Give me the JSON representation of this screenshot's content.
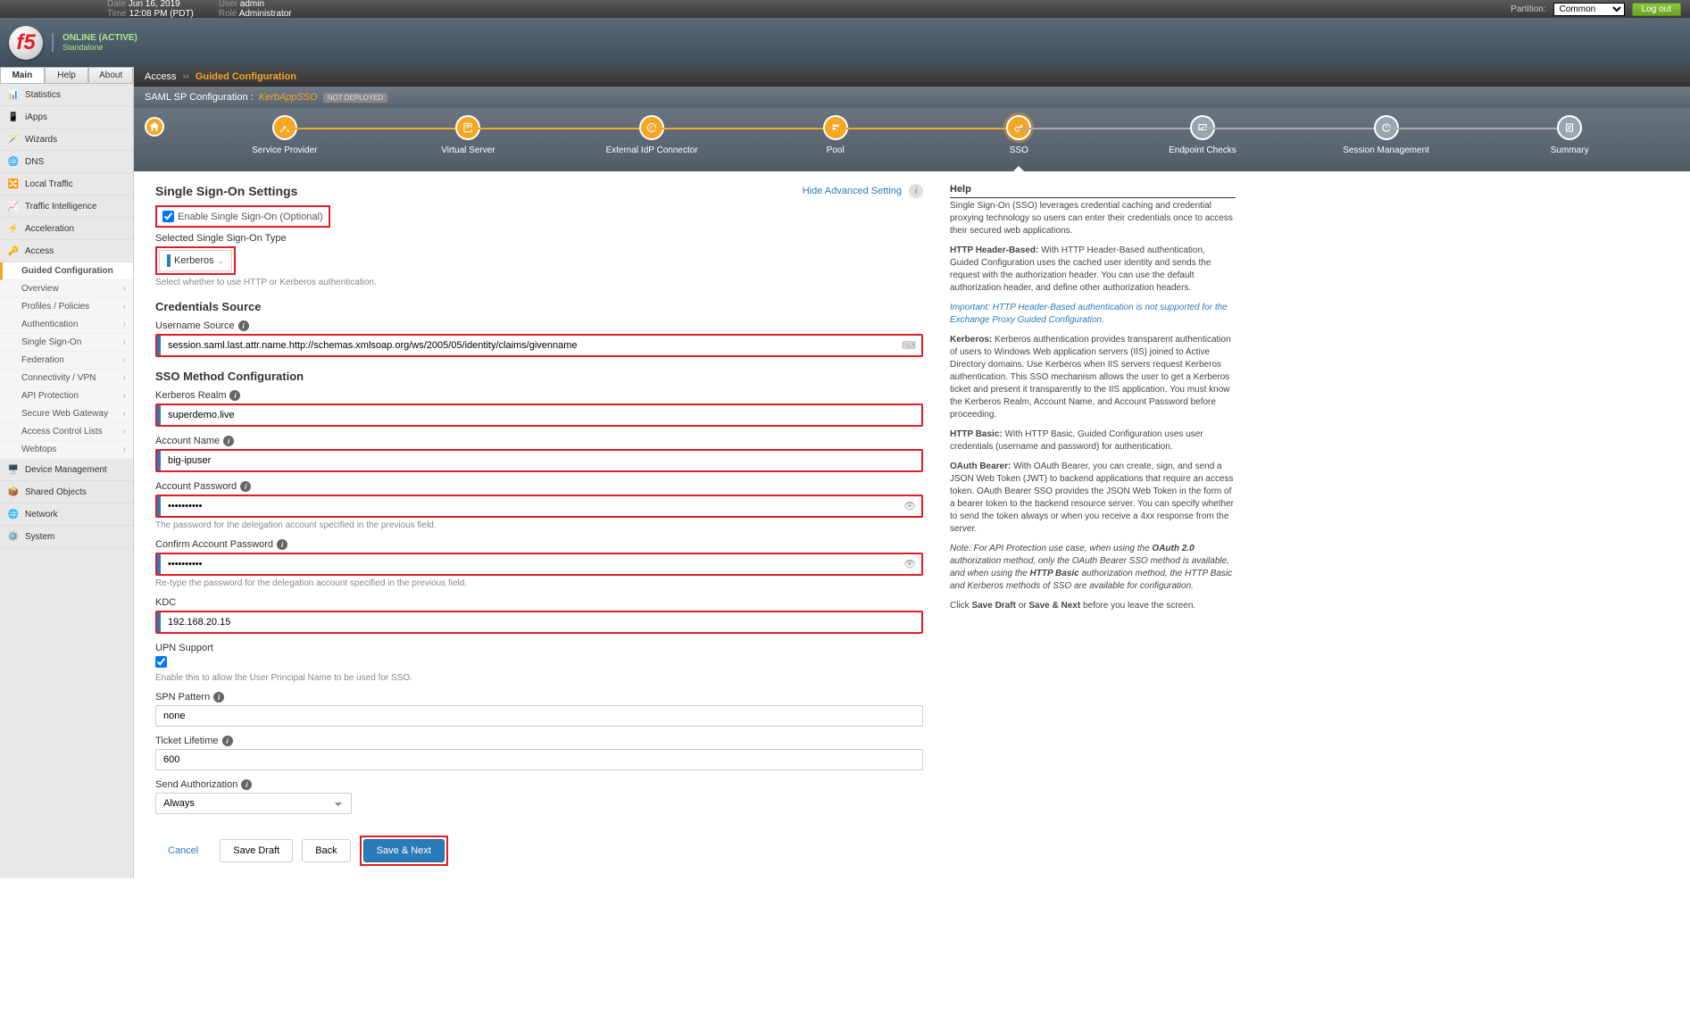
{
  "topbar": {
    "date_label": "Date",
    "date_value": "Jun 16, 2019",
    "time_label": "Time",
    "time_value": "12:08 PM (PDT)",
    "user_label": "User",
    "user_value": "admin",
    "role_label": "Role",
    "role_value": "Administrator",
    "partition_label": "Partition:",
    "partition_value": "Common",
    "logout": "Log out"
  },
  "header": {
    "logo_text": "f5",
    "status_primary": "ONLINE (ACTIVE)",
    "status_secondary": "Standalone"
  },
  "sidebar_tabs": {
    "main": "Main",
    "help": "Help",
    "about": "About"
  },
  "nav": {
    "statistics": "Statistics",
    "iapps": "iApps",
    "wizards": "Wizards",
    "dns": "DNS",
    "local_traffic": "Local Traffic",
    "traffic_intel": "Traffic Intelligence",
    "acceleration": "Acceleration",
    "access": "Access",
    "device_mgmt": "Device Management",
    "shared_objects": "Shared Objects",
    "network": "Network",
    "system": "System"
  },
  "access_sub": {
    "guided": "Guided Configuration",
    "overview": "Overview",
    "profiles": "Profiles / Policies",
    "authentication": "Authentication",
    "sso": "Single Sign-On",
    "federation": "Federation",
    "connectivity": "Connectivity / VPN",
    "api_protection": "API Protection",
    "swg": "Secure Web Gateway",
    "acl": "Access Control Lists",
    "webtops": "Webtops"
  },
  "breadcrumb": {
    "root": "Access",
    "current": "Guided Configuration"
  },
  "config": {
    "prefix": "SAML SP Configuration :",
    "name": "KerbAppSSO",
    "badge": "NOT DEPLOYED"
  },
  "steps": {
    "sp": "Service Provider",
    "vs": "Virtual Server",
    "idp": "External IdP Connector",
    "pool": "Pool",
    "sso": "SSO",
    "endpoint": "Endpoint Checks",
    "session": "Session Management",
    "summary": "Summary"
  },
  "sso_settings": {
    "title": "Single Sign-On Settings",
    "hide_advanced": "Hide Advanced Setting",
    "enable_label": "Enable Single Sign-On (Optional)",
    "enable_checked": true,
    "type_label": "Selected Single Sign-On Type",
    "type_value": "Kerberos",
    "type_help": "Select whether to use HTTP or Kerberos authentication."
  },
  "credentials": {
    "title": "Credentials Source",
    "username_label": "Username Source",
    "username_value": "session.saml.last.attr.name.http://schemas.xmlsoap.org/ws/2005/05/identity/claims/givenname"
  },
  "method": {
    "title": "SSO Method Configuration",
    "realm_label": "Kerberos Realm",
    "realm_value": "superdemo.live",
    "account_name_label": "Account Name",
    "account_name_value": "big-ipuser",
    "account_pw_label": "Account Password",
    "account_pw_value": "••••••••••",
    "account_pw_help": "The password for the delegation account specified in the previous field.",
    "confirm_pw_label": "Confirm Account Password",
    "confirm_pw_value": "••••••••••",
    "confirm_pw_help": "Re-type the password for the delegation account specified in the previous field.",
    "kdc_label": "KDC",
    "kdc_value": "192.168.20.15",
    "upn_label": "UPN Support",
    "upn_checked": true,
    "upn_help": "Enable this to allow the User Principal Name to be used for SSO.",
    "spn_label": "SPN Pattern",
    "spn_value": "none",
    "ticket_label": "Ticket Lifetime",
    "ticket_value": "600",
    "send_auth_label": "Send Authorization",
    "send_auth_value": "Always"
  },
  "actions": {
    "cancel": "Cancel",
    "save_draft": "Save Draft",
    "back": "Back",
    "save_next": "Save & Next"
  },
  "help": {
    "title": "Help",
    "p1": "Single Sign-On (SSO) leverages credential caching and credential proxying technology so users can enter their credentials once to access their secured web applications.",
    "p2_label": "HTTP Header-Based:",
    "p2": " With HTTP Header-Based authentication, Guided Configuration uses the cached user identity and sends the request with the authorization header. You can use the default authorization header, and define other authorization headers.",
    "p3_em": "Important: HTTP Header-Based authentication is not supported for the Exchange Proxy Guided Configuration.",
    "p4_label": "Kerberos:",
    "p4": " Kerberos authentication provides transparent authentication of users to Windows Web application servers (IIS) joined to Active Directory domains. Use Kerberos when IIS servers request Kerberos authentication. This SSO mechanism allows the user to get a Kerberos ticket and present it transparently to the IIS application. You must know the Kerberos Realm, Account Name, and Account Password before proceeding.",
    "p5_label": "HTTP Basic:",
    "p5": " With HTTP Basic, Guided Configuration uses user credentials (username and password) for authentication.",
    "p6_label": "OAuth Bearer:",
    "p6": " With OAuth Bearer, you can create, sign, and send a JSON Web Token (JWT) to backend applications that require an access token. OAuth Bearer SSO provides the JSON Web Token in the form of a bearer token to the backend resource server. You can specify whether to send the token always or when you receive a 4xx response from the server.",
    "note1": "Note: For API Protection use case, when using the ",
    "note1b": "OAuth 2.0",
    "note1c": " authorization method, only the OAuth Bearer SSO method is available, and when using the ",
    "note1d": "HTTP Basic",
    "note1e": " authorization method, the HTTP Basic and Kerberos methods of SSO are available for configuration.",
    "final1": "Click ",
    "final2": "Save Draft",
    "final3": " or ",
    "final4": "Save & Next",
    "final5": " before you leave the screen."
  }
}
